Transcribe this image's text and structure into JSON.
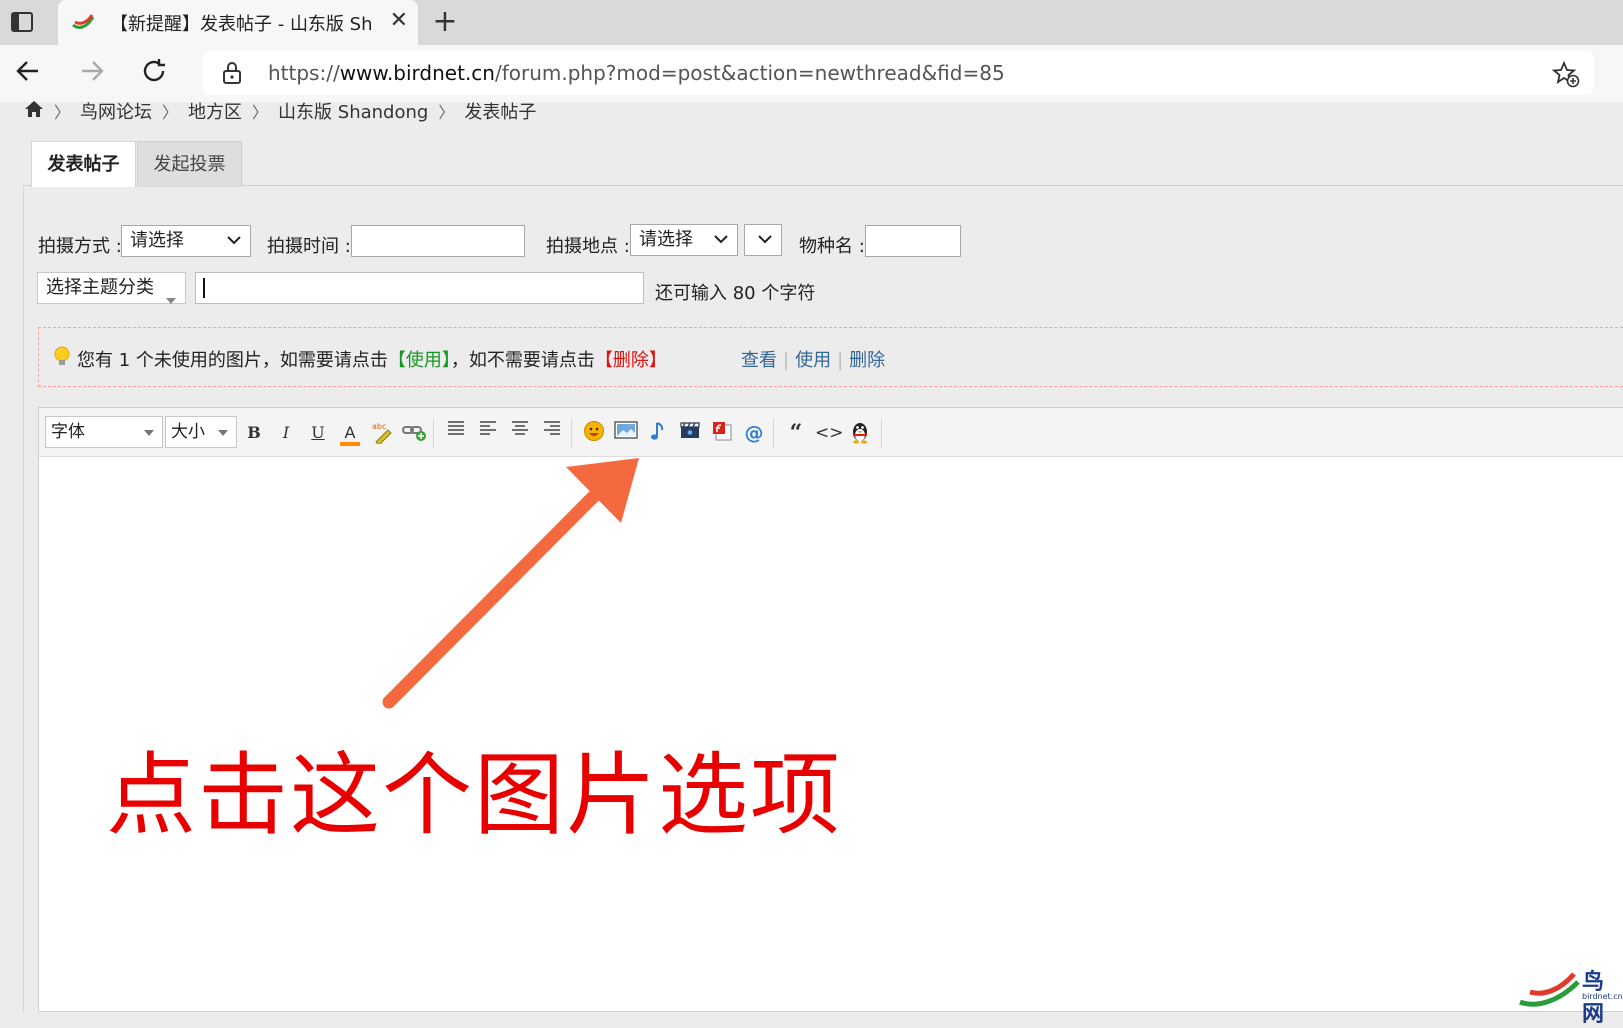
{
  "browser": {
    "tab_title": "【新提醒】发表帖子 - 山东版 Sh",
    "url_prefix": "https://",
    "url_domain": "www.birdnet.cn",
    "url_rest": "/forum.php?mod=post&action=newthread&fid=85"
  },
  "breadcrumb": [
    "鸟网论坛",
    "地方区",
    "山东版 Shandong",
    "发表帖子"
  ],
  "tabs": {
    "post": "发表帖子",
    "poll": "发起投票"
  },
  "form": {
    "shoot_method_label": "拍摄方式 :",
    "shoot_method_value": "请选择",
    "shoot_time_label": "拍摄时间 :",
    "shoot_place_label": "拍摄地点 :",
    "shoot_place_value": "请选择",
    "species_label": "物种名 :",
    "category_value": "选择主题分类",
    "remaining_text": "还可输入 80 个字符"
  },
  "notice": {
    "part1": "您有 1 个未使用的图片，如需要请点击",
    "use_bracket": "【使用】",
    "part2": "，如不需要请点击",
    "delete_bracket": "【删除】",
    "view": "查看",
    "use": "使用",
    "delete": "删除"
  },
  "toolbar": {
    "font_label": "字体",
    "size_label": "大小",
    "bold": "B",
    "italic": "I",
    "underline": "U",
    "color": "A",
    "quote": "“",
    "code": "<>"
  },
  "annotation": {
    "callout_text": "点击这个图片选项",
    "arrow_color": "#f4693f"
  },
  "watermark": {
    "text": "鸟网",
    "subtext": "birdnet.cn"
  }
}
